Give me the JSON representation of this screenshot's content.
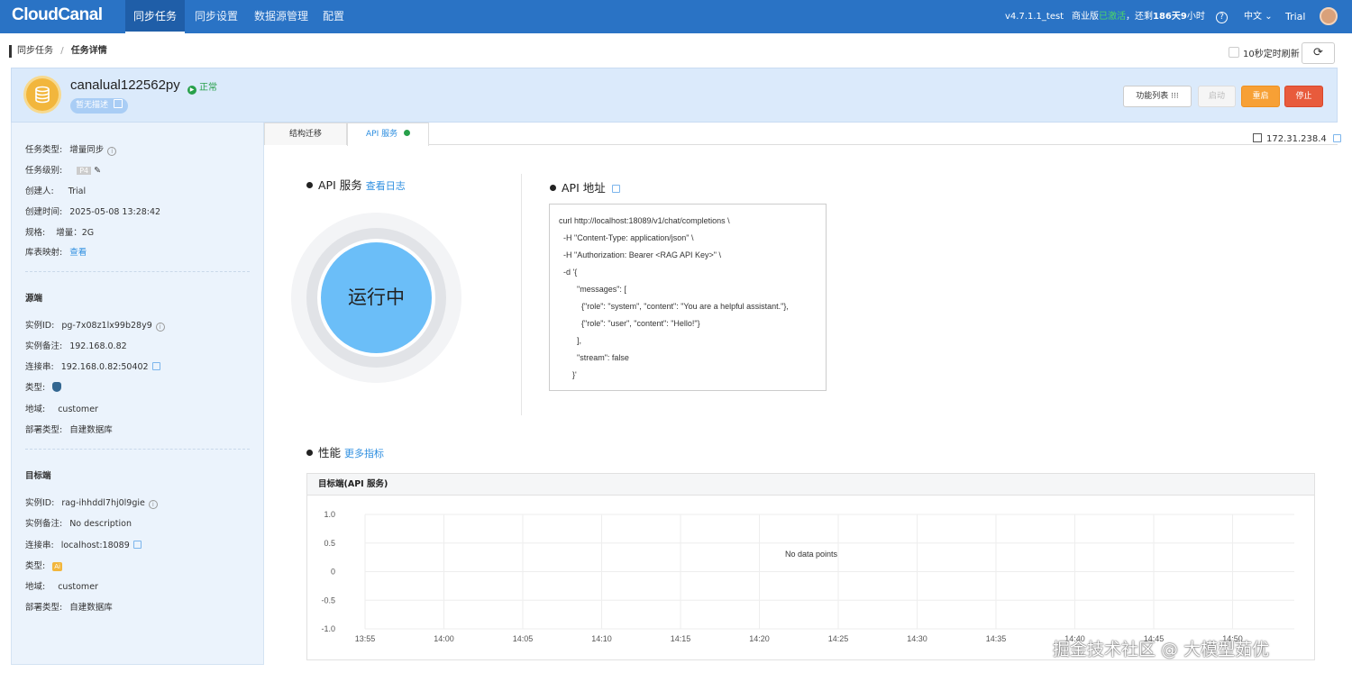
{
  "app": {
    "logo": "CloudCanal"
  },
  "nav": {
    "items": [
      "同步任务",
      "同步设置",
      "数据源管理",
      "配置"
    ],
    "version": "v4.7.1.1_test",
    "license_prefix": "商业版",
    "license_status": "已激活",
    "license_suffix": "，还剩",
    "license_remaining": "186天9",
    "license_unit": "小时",
    "help_icon": "question-icon",
    "lang": "中文",
    "user": "Trial"
  },
  "breadcrumb": {
    "parent": "同步任务",
    "separator": "/",
    "current": "任务详情"
  },
  "refresh": {
    "label": "10秒定时刷新",
    "checked": false
  },
  "task": {
    "name": "canalual122562py",
    "status": "正常",
    "desc": "暂无描述",
    "buttons": {
      "features": "功能列表",
      "start": "启动",
      "restart": "重启",
      "stop": "停止"
    }
  },
  "sidebar": {
    "task_info": [
      {
        "label": "任务类型:",
        "value": "增量同步"
      },
      {
        "label": "任务级别:",
        "value": "P4"
      },
      {
        "label": "创建人:",
        "value": "Trial"
      },
      {
        "label": "创建时间:",
        "value": "2025-05-08 13:28:42"
      },
      {
        "label": "规格:",
        "value": "增量：2G"
      },
      {
        "label": "库表映射:",
        "value": "查看"
      }
    ],
    "source": {
      "title": "源端",
      "rows": [
        {
          "label": "实例ID:",
          "value": "pg-7x08z1lx99b28y9"
        },
        {
          "label": "实例备注:",
          "value": "192.168.0.82"
        },
        {
          "label": "连接串:",
          "value": "192.168.0.82:50402"
        },
        {
          "label": "类型:",
          "value": ""
        },
        {
          "label": "地域:",
          "value": "customer"
        },
        {
          "label": "部署类型:",
          "value": "自建数据库"
        }
      ]
    },
    "target": {
      "title": "目标端",
      "rows": [
        {
          "label": "实例ID:",
          "value": "rag-ihhddl7hj0l9gie"
        },
        {
          "label": "实例备注:",
          "value": "No description"
        },
        {
          "label": "连接串:",
          "value": "localhost:18089"
        },
        {
          "label": "类型:",
          "value": "Ai"
        },
        {
          "label": "地域:",
          "value": "customer"
        },
        {
          "label": "部署类型:",
          "value": "自建数据库"
        }
      ]
    }
  },
  "tabs": [
    "结构迁移",
    "API 服务"
  ],
  "ip": "172.31.238.4",
  "api_service": {
    "title": "API 服务",
    "link": "查看日志",
    "state": "运行中"
  },
  "api_address": {
    "title": "API 地址",
    "code_lines": [
      "curl http://localhost:18089/v1/chat/completions \\",
      "  -H \"Content-Type: application/json\" \\",
      "  -H \"Authorization: Bearer <RAG API Key>\" \\",
      "  -d '{",
      "        \"messages\": [",
      "          {\"role\": \"system\", \"content\": \"You are a helpful assistant.\"},",
      "          {\"role\": \"user\", \"content\": \"Hello!\"}",
      "        ],",
      "        \"stream\": false",
      "      }'"
    ]
  },
  "performance": {
    "title": "性能",
    "link": "更多指标",
    "chart_title": "目标端(API 服务)"
  },
  "chart_data": {
    "type": "line",
    "title": "目标端(API 服务)",
    "x": [
      "13:55",
      "14:00",
      "14:05",
      "14:10",
      "14:15",
      "14:20",
      "14:25",
      "14:30",
      "14:35",
      "14:40",
      "14:45",
      "14:50"
    ],
    "y_ticks": [
      "1.0",
      "0.5",
      "0",
      "-0.5",
      "-1.0"
    ],
    "ylim": [
      -1.0,
      1.0
    ],
    "series": [],
    "empty_message": "No data points",
    "grid": true
  },
  "watermark": "掘金技术社区 @ 大模型茹优"
}
